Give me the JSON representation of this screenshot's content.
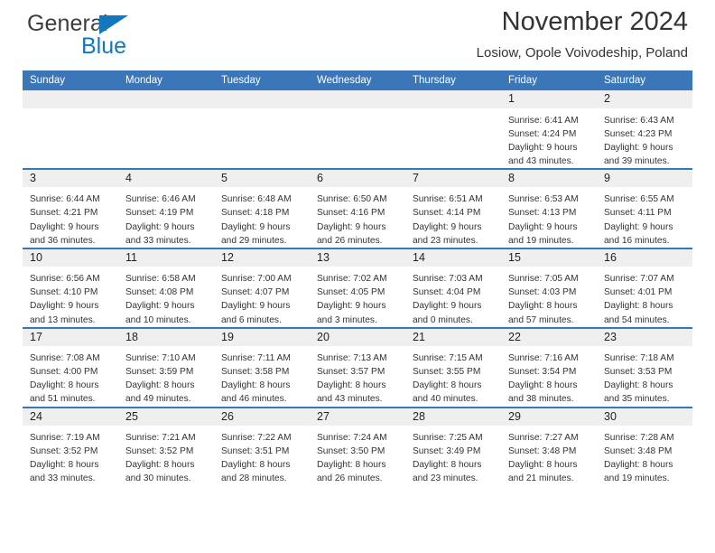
{
  "brand": {
    "name_part1": "General",
    "name_part2": "Blue",
    "accent_color": "#1277bd"
  },
  "header": {
    "title": "November 2024",
    "subtitle": "Losiow, Opole Voivodeship, Poland"
  },
  "calendar": {
    "header_color": "#3b77b8",
    "daynum_band_color": "#efefef",
    "columns": [
      "Sunday",
      "Monday",
      "Tuesday",
      "Wednesday",
      "Thursday",
      "Friday",
      "Saturday"
    ],
    "weeks": [
      [
        {
          "day": "",
          "lines": []
        },
        {
          "day": "",
          "lines": []
        },
        {
          "day": "",
          "lines": []
        },
        {
          "day": "",
          "lines": []
        },
        {
          "day": "",
          "lines": []
        },
        {
          "day": "1",
          "lines": [
            "Sunrise: 6:41 AM",
            "Sunset: 4:24 PM",
            "Daylight: 9 hours",
            "and 43 minutes."
          ]
        },
        {
          "day": "2",
          "lines": [
            "Sunrise: 6:43 AM",
            "Sunset: 4:23 PM",
            "Daylight: 9 hours",
            "and 39 minutes."
          ]
        }
      ],
      [
        {
          "day": "3",
          "lines": [
            "Sunrise: 6:44 AM",
            "Sunset: 4:21 PM",
            "Daylight: 9 hours",
            "and 36 minutes."
          ]
        },
        {
          "day": "4",
          "lines": [
            "Sunrise: 6:46 AM",
            "Sunset: 4:19 PM",
            "Daylight: 9 hours",
            "and 33 minutes."
          ]
        },
        {
          "day": "5",
          "lines": [
            "Sunrise: 6:48 AM",
            "Sunset: 4:18 PM",
            "Daylight: 9 hours",
            "and 29 minutes."
          ]
        },
        {
          "day": "6",
          "lines": [
            "Sunrise: 6:50 AM",
            "Sunset: 4:16 PM",
            "Daylight: 9 hours",
            "and 26 minutes."
          ]
        },
        {
          "day": "7",
          "lines": [
            "Sunrise: 6:51 AM",
            "Sunset: 4:14 PM",
            "Daylight: 9 hours",
            "and 23 minutes."
          ]
        },
        {
          "day": "8",
          "lines": [
            "Sunrise: 6:53 AM",
            "Sunset: 4:13 PM",
            "Daylight: 9 hours",
            "and 19 minutes."
          ]
        },
        {
          "day": "9",
          "lines": [
            "Sunrise: 6:55 AM",
            "Sunset: 4:11 PM",
            "Daylight: 9 hours",
            "and 16 minutes."
          ]
        }
      ],
      [
        {
          "day": "10",
          "lines": [
            "Sunrise: 6:56 AM",
            "Sunset: 4:10 PM",
            "Daylight: 9 hours",
            "and 13 minutes."
          ]
        },
        {
          "day": "11",
          "lines": [
            "Sunrise: 6:58 AM",
            "Sunset: 4:08 PM",
            "Daylight: 9 hours",
            "and 10 minutes."
          ]
        },
        {
          "day": "12",
          "lines": [
            "Sunrise: 7:00 AM",
            "Sunset: 4:07 PM",
            "Daylight: 9 hours",
            "and 6 minutes."
          ]
        },
        {
          "day": "13",
          "lines": [
            "Sunrise: 7:02 AM",
            "Sunset: 4:05 PM",
            "Daylight: 9 hours",
            "and 3 minutes."
          ]
        },
        {
          "day": "14",
          "lines": [
            "Sunrise: 7:03 AM",
            "Sunset: 4:04 PM",
            "Daylight: 9 hours",
            "and 0 minutes."
          ]
        },
        {
          "day": "15",
          "lines": [
            "Sunrise: 7:05 AM",
            "Sunset: 4:03 PM",
            "Daylight: 8 hours",
            "and 57 minutes."
          ]
        },
        {
          "day": "16",
          "lines": [
            "Sunrise: 7:07 AM",
            "Sunset: 4:01 PM",
            "Daylight: 8 hours",
            "and 54 minutes."
          ]
        }
      ],
      [
        {
          "day": "17",
          "lines": [
            "Sunrise: 7:08 AM",
            "Sunset: 4:00 PM",
            "Daylight: 8 hours",
            "and 51 minutes."
          ]
        },
        {
          "day": "18",
          "lines": [
            "Sunrise: 7:10 AM",
            "Sunset: 3:59 PM",
            "Daylight: 8 hours",
            "and 49 minutes."
          ]
        },
        {
          "day": "19",
          "lines": [
            "Sunrise: 7:11 AM",
            "Sunset: 3:58 PM",
            "Daylight: 8 hours",
            "and 46 minutes."
          ]
        },
        {
          "day": "20",
          "lines": [
            "Sunrise: 7:13 AM",
            "Sunset: 3:57 PM",
            "Daylight: 8 hours",
            "and 43 minutes."
          ]
        },
        {
          "day": "21",
          "lines": [
            "Sunrise: 7:15 AM",
            "Sunset: 3:55 PM",
            "Daylight: 8 hours",
            "and 40 minutes."
          ]
        },
        {
          "day": "22",
          "lines": [
            "Sunrise: 7:16 AM",
            "Sunset: 3:54 PM",
            "Daylight: 8 hours",
            "and 38 minutes."
          ]
        },
        {
          "day": "23",
          "lines": [
            "Sunrise: 7:18 AM",
            "Sunset: 3:53 PM",
            "Daylight: 8 hours",
            "and 35 minutes."
          ]
        }
      ],
      [
        {
          "day": "24",
          "lines": [
            "Sunrise: 7:19 AM",
            "Sunset: 3:52 PM",
            "Daylight: 8 hours",
            "and 33 minutes."
          ]
        },
        {
          "day": "25",
          "lines": [
            "Sunrise: 7:21 AM",
            "Sunset: 3:52 PM",
            "Daylight: 8 hours",
            "and 30 minutes."
          ]
        },
        {
          "day": "26",
          "lines": [
            "Sunrise: 7:22 AM",
            "Sunset: 3:51 PM",
            "Daylight: 8 hours",
            "and 28 minutes."
          ]
        },
        {
          "day": "27",
          "lines": [
            "Sunrise: 7:24 AM",
            "Sunset: 3:50 PM",
            "Daylight: 8 hours",
            "and 26 minutes."
          ]
        },
        {
          "day": "28",
          "lines": [
            "Sunrise: 7:25 AM",
            "Sunset: 3:49 PM",
            "Daylight: 8 hours",
            "and 23 minutes."
          ]
        },
        {
          "day": "29",
          "lines": [
            "Sunrise: 7:27 AM",
            "Sunset: 3:48 PM",
            "Daylight: 8 hours",
            "and 21 minutes."
          ]
        },
        {
          "day": "30",
          "lines": [
            "Sunrise: 7:28 AM",
            "Sunset: 3:48 PM",
            "Daylight: 8 hours",
            "and 19 minutes."
          ]
        }
      ]
    ]
  }
}
